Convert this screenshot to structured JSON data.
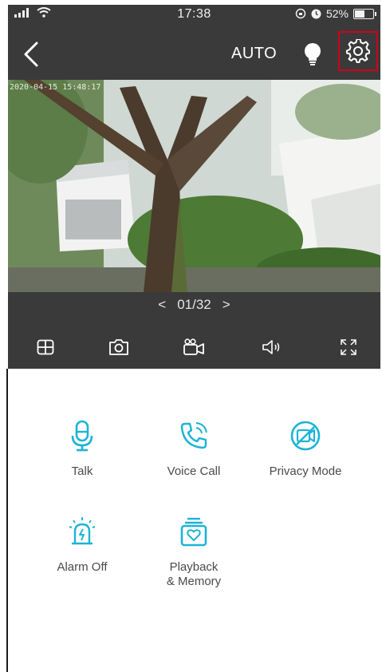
{
  "status_bar": {
    "time": "17:38",
    "battery_text": "52%",
    "battery_level": 0.52
  },
  "header": {
    "mode_label": "AUTO"
  },
  "video": {
    "timestamp": "2020-04-15 15:48:17"
  },
  "pager": {
    "prev": "<",
    "text": "01/32",
    "next": ">"
  },
  "toolbar": {
    "icons": [
      "grid-layout-icon",
      "snapshot-camera-icon",
      "record-video-icon",
      "speaker-icon",
      "fullscreen-icon"
    ]
  },
  "actions": [
    {
      "label": "Talk",
      "icon": "microphone-icon"
    },
    {
      "label": "Voice Call",
      "icon": "phone-call-icon"
    },
    {
      "label": "Privacy Mode",
      "icon": "camera-off-icon"
    },
    {
      "label": "Alarm Off",
      "icon": "alarm-siren-icon"
    },
    {
      "label_line1": "Playback",
      "label_line2": "& Memory",
      "icon": "playback-memory-icon"
    }
  ],
  "colors": {
    "accent": "#1cb3d6",
    "dark_bg": "#3a3a3a",
    "highlight_box": "#d0021b"
  }
}
